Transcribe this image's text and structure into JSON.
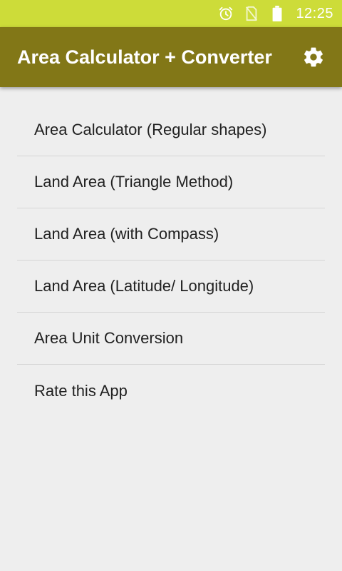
{
  "status_bar": {
    "time": "12:25",
    "icons": [
      "alarm-icon",
      "no-sim-icon",
      "battery-icon"
    ],
    "color": "#cddc39"
  },
  "app_bar": {
    "title": "Area Calculator + Converter",
    "action_icon": "gear-icon",
    "color": "#827717"
  },
  "menu": {
    "items": [
      {
        "label": "Area Calculator (Regular shapes)"
      },
      {
        "label": "Land Area (Triangle Method)"
      },
      {
        "label": "Land Area (with Compass)"
      },
      {
        "label": "Land Area (Latitude/ Longitude)"
      },
      {
        "label": "Area Unit Conversion"
      },
      {
        "label": "Rate this App"
      }
    ]
  }
}
